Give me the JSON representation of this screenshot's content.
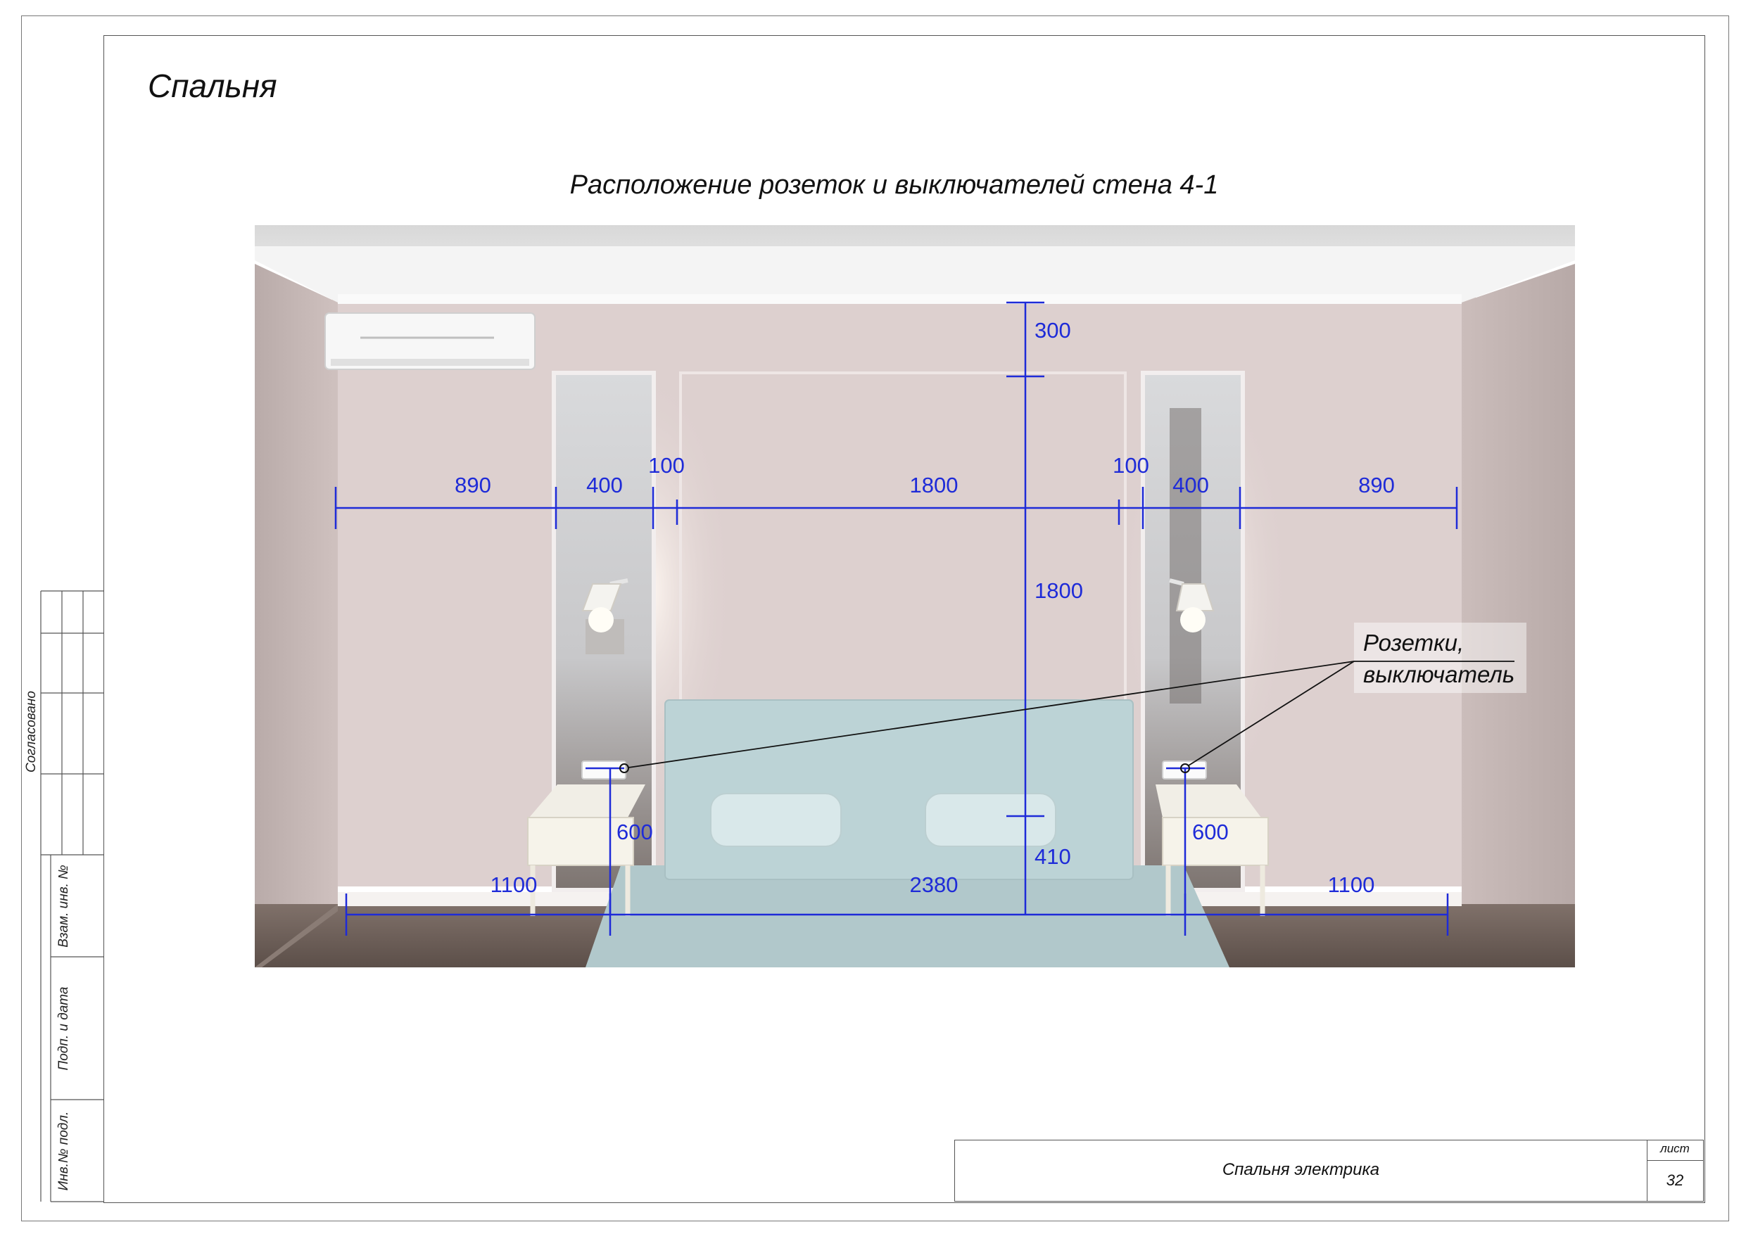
{
  "sheet": {
    "heading": "Спальня",
    "drawing_title": "Расположение розеток и выключателей стена 4-1"
  },
  "side_stamp": {
    "approved_label": "Согласовано",
    "replace_inv_label": "Взам. инв. №",
    "sign_date_label": "Подп. и дата",
    "inv_orig_label": "Инв.№ подл."
  },
  "title_block": {
    "document_name": "Спальня электрика",
    "sheet_label": "лист",
    "sheet_number": "32"
  },
  "dimensions": {
    "horizontal_top": [
      "890",
      "400",
      "100",
      "1800",
      "100",
      "400",
      "890"
    ],
    "vertical_center": [
      "300",
      "1800",
      "410"
    ],
    "socket_height_left": "600",
    "socket_height_right": "600",
    "horizontal_bottom": [
      "1100",
      "2380",
      "1100"
    ]
  },
  "callout": {
    "line1": "Розетки,",
    "line2": "выключатель"
  },
  "colors": {
    "dimension_blue": "#1e2bd8",
    "wall": "#ddd0cf",
    "headboard": "#bcd3d6",
    "rug": "#b1c8cb",
    "floor": "#6e6058"
  }
}
